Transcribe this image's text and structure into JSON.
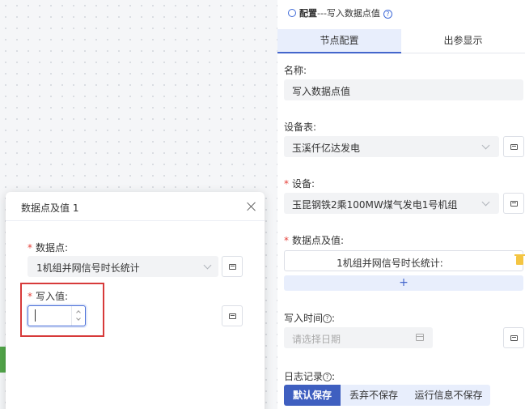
{
  "modal": {
    "title": "数据点及值 1",
    "datapoint_label": "数据点:",
    "datapoint_value": "1机组并网信号时长统计",
    "write_value_label": "写入值:",
    "write_value": ""
  },
  "panel": {
    "title_prefix": "配置",
    "title_suffix": "---写入数据点值",
    "tabs": [
      {
        "label": "节点配置",
        "active": true
      },
      {
        "label": "出参显示",
        "active": false
      }
    ],
    "name_label": "名称:",
    "name_value": "写入数据点值",
    "device_table_label": "设备表:",
    "device_table_value": "玉溪仟亿达发电",
    "device_label": "设备:",
    "device_value": "玉昆钢铁2乘100MW煤气发电1号机组",
    "datapoint_label": "数据点及值:",
    "datapoint_item": "1机组并网信号时长统计:",
    "add_symbol": "+",
    "write_time_label": "写入时间",
    "write_time_placeholder": "请选择日期",
    "log_label": "日志记录",
    "log_options": [
      {
        "label": "默认保存",
        "active": true
      },
      {
        "label": "丢弃不保存",
        "active": false
      },
      {
        "label": "运行信息不保存",
        "active": false
      }
    ],
    "help_glyph": "?"
  },
  "colors": {
    "accent": "#3f5fc0",
    "required": "#e5413a",
    "highlight": "#d73a3a"
  }
}
